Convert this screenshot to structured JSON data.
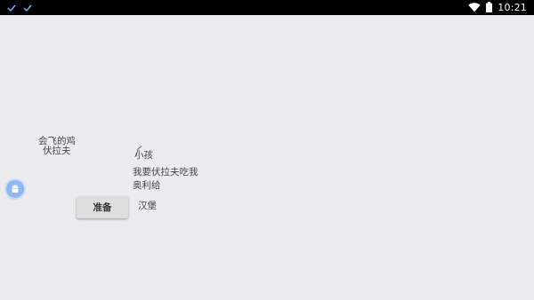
{
  "status_bar": {
    "left_icons": [
      "check-icon",
      "check-icon"
    ],
    "wifi_icon": "wifi-icon",
    "battery_icon": "battery-icon",
    "time": "10:21"
  },
  "labels": {
    "flying_chicken": "会飞的鸡",
    "vodka": "伏拉夫",
    "kid": "小孩",
    "i_want_vodka_eat_me": "我要伏拉夫吃我",
    "orly": "奥利给",
    "hamburger": "汉堡"
  },
  "buttons": {
    "ready": "准备"
  },
  "floating_icon": "android-icon",
  "colors": {
    "background": "#ebebf0",
    "status_bar": "#000000",
    "fab": "#8fb7f2"
  }
}
